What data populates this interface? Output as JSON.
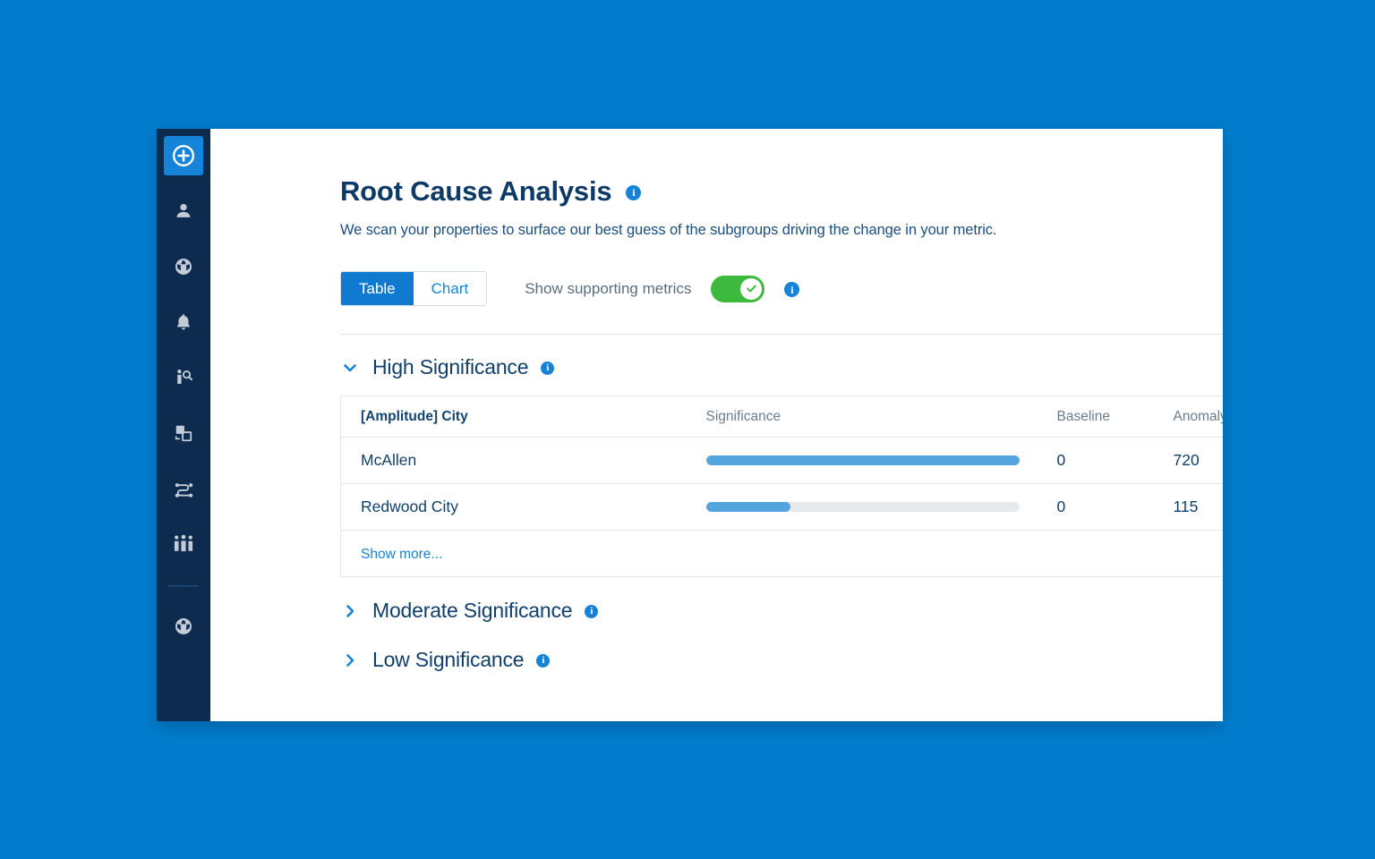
{
  "theme": {
    "page_background": "#027DCE",
    "sidebar_background": "#0C2B4E",
    "accent_blue": "#1583D8",
    "title_navy": "#0D3A66",
    "toggle_green": "#3DBA3D",
    "bar_fill": "#54A5DD",
    "bar_track": "#E6EAED"
  },
  "sidebar": {
    "items": [
      {
        "icon": "plus-circle-icon",
        "label": "Create New",
        "active": true
      },
      {
        "icon": "user-icon",
        "label": "Users",
        "active": false
      },
      {
        "icon": "amplitude-logo-icon",
        "label": "Analytics",
        "active": false
      },
      {
        "icon": "bell-icon",
        "label": "Alerts",
        "active": false
      },
      {
        "icon": "user-search-icon",
        "label": "User Lookup",
        "active": false
      },
      {
        "icon": "compare-windows-icon",
        "label": "Compare",
        "active": false
      },
      {
        "icon": "pathfinder-flow-icon",
        "label": "Pathfinder",
        "active": false
      },
      {
        "icon": "people-group-icon",
        "label": "Cohorts",
        "active": false
      }
    ],
    "footer_items": [
      {
        "icon": "amplitude-logo-icon",
        "label": "Amplitude",
        "active": false
      }
    ]
  },
  "header": {
    "title": "Root Cause Analysis",
    "title_info_icon": "info-icon",
    "subtitle": "We scan your properties to surface our best guess of the subgroups driving the change in your metric."
  },
  "controls": {
    "view_toggle": {
      "options": [
        {
          "label": "Table",
          "selected": true
        },
        {
          "label": "Chart",
          "selected": false
        }
      ]
    },
    "supporting_metrics": {
      "label": "Show supporting metrics",
      "enabled": true,
      "switch_icon": "check-icon",
      "info_icon": "info-icon"
    }
  },
  "sections": [
    {
      "title": "High Significance",
      "expanded": true,
      "chevron": "chevron-down-icon",
      "info_icon": "info-icon"
    },
    {
      "title": "Moderate Significance",
      "expanded": false,
      "chevron": "chevron-right-icon",
      "info_icon": "info-icon"
    },
    {
      "title": "Low Significance",
      "expanded": false,
      "chevron": "chevron-right-icon",
      "info_icon": "info-icon"
    }
  ],
  "table": {
    "columns": [
      "[Amplitude] City",
      "Significance",
      "Baseline",
      "Anomaly"
    ],
    "rows": [
      {
        "name": "McAllen",
        "significance_pct": 100,
        "baseline": "0",
        "anomaly": "720"
      },
      {
        "name": "Redwood City",
        "significance_pct": 27,
        "baseline": "0",
        "anomaly": "115"
      }
    ],
    "show_more_label": "Show more..."
  },
  "chart_data": {
    "type": "bar",
    "title": "Significance",
    "categories": [
      "McAllen",
      "Redwood City"
    ],
    "values": [
      100,
      27
    ],
    "xlabel": "",
    "ylabel": "Significance",
    "ylim": [
      0,
      100
    ],
    "orientation": "horizontal",
    "grid": false,
    "legend": "none"
  }
}
